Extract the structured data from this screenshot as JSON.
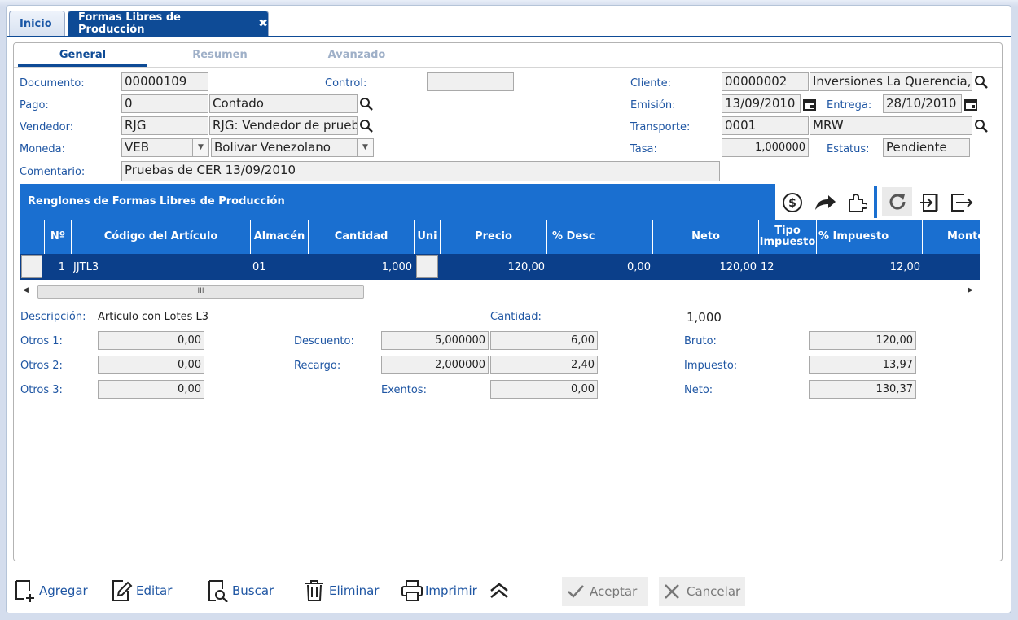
{
  "tabs": [
    {
      "label": "Inicio"
    },
    {
      "label": "Formas Libres de Producción"
    }
  ],
  "tab_close": "✖",
  "subtabs": [
    {
      "label": "General"
    },
    {
      "label": "Resumen"
    },
    {
      "label": "Avanzado"
    }
  ],
  "form": {
    "documento": {
      "label": "Documento:",
      "value": "00000109"
    },
    "control": {
      "label": "Control:",
      "value": ""
    },
    "cliente": {
      "label": "Cliente:",
      "code": "00000002",
      "name": "Inversiones La Querencia, C"
    },
    "pago": {
      "label": "Pago:",
      "code": "0",
      "name": "Contado"
    },
    "emision": {
      "label": "Emisión:",
      "value": "13/09/2010"
    },
    "entrega": {
      "label": "Entrega:",
      "value": "28/10/2010"
    },
    "vendedor": {
      "label": "Vendedor:",
      "code": "RJG",
      "name": "RJG: Vendedor de prueba"
    },
    "transporte": {
      "label": "Transporte:",
      "code": "0001",
      "name": "MRW"
    },
    "moneda": {
      "label": "Moneda:",
      "code": "VEB",
      "name": "Bolivar Venezolano"
    },
    "tasa": {
      "label": "Tasa:",
      "value": "1,000000"
    },
    "estatus": {
      "label": "Estatus:",
      "value": "Pendiente"
    },
    "comentario": {
      "label": "Comentario:",
      "value": "Pruebas de CER 13/09/2010"
    }
  },
  "grid": {
    "title": "Renglones de Formas Libres de Producción",
    "columns": [
      "Nº",
      "Código del Artículo",
      "Almacén",
      "Cantidad",
      "Uni",
      "Precio",
      "% Desc",
      "Neto",
      "Tipo Impuesto",
      "% Impuesto",
      "Monto Impuesto"
    ],
    "rows": [
      {
        "n": "1",
        "codigo": "JJTL3",
        "almacen": "01",
        "cantidad": "1,000",
        "precio": "120,00",
        "desc": "0,00",
        "neto": "120,00",
        "tipo": "12",
        "pimp": "12,00"
      }
    ],
    "scroll_grip": "III"
  },
  "detail": {
    "descripcion_label": "Descripción:",
    "descripcion": "Articulo con Lotes L3",
    "cantidad_label": "Cantidad:",
    "cantidad": "1,000",
    "otros1_label": "Otros 1:",
    "otros1": "0,00",
    "otros2_label": "Otros 2:",
    "otros2": "0,00",
    "otros3_label": "Otros 3:",
    "otros3": "0,00",
    "descuento_label": "Descuento:",
    "descuento_pct": "5,000000",
    "descuento_amt": "6,00",
    "recargo_label": "Recargo:",
    "recargo_pct": "2,000000",
    "recargo_amt": "2,40",
    "exentos_label": "Exentos:",
    "exentos": "0,00",
    "bruto_label": "Bruto:",
    "bruto": "120,00",
    "impuesto_label": "Impuesto:",
    "impuesto": "13,97",
    "neto_label": "Neto:",
    "neto": "130,37"
  },
  "toolbar": {
    "agregar": "Agregar",
    "editar": "Editar",
    "buscar": "Buscar",
    "eliminar": "Eliminar",
    "imprimir": "Imprimir",
    "aceptar": "Aceptar",
    "cancelar": "Cancelar"
  },
  "colors": {
    "accent": "#0e4b96",
    "grid_header": "#1a6fd0",
    "selected_row": "#0b3f8a",
    "label": "#1f56a3"
  }
}
